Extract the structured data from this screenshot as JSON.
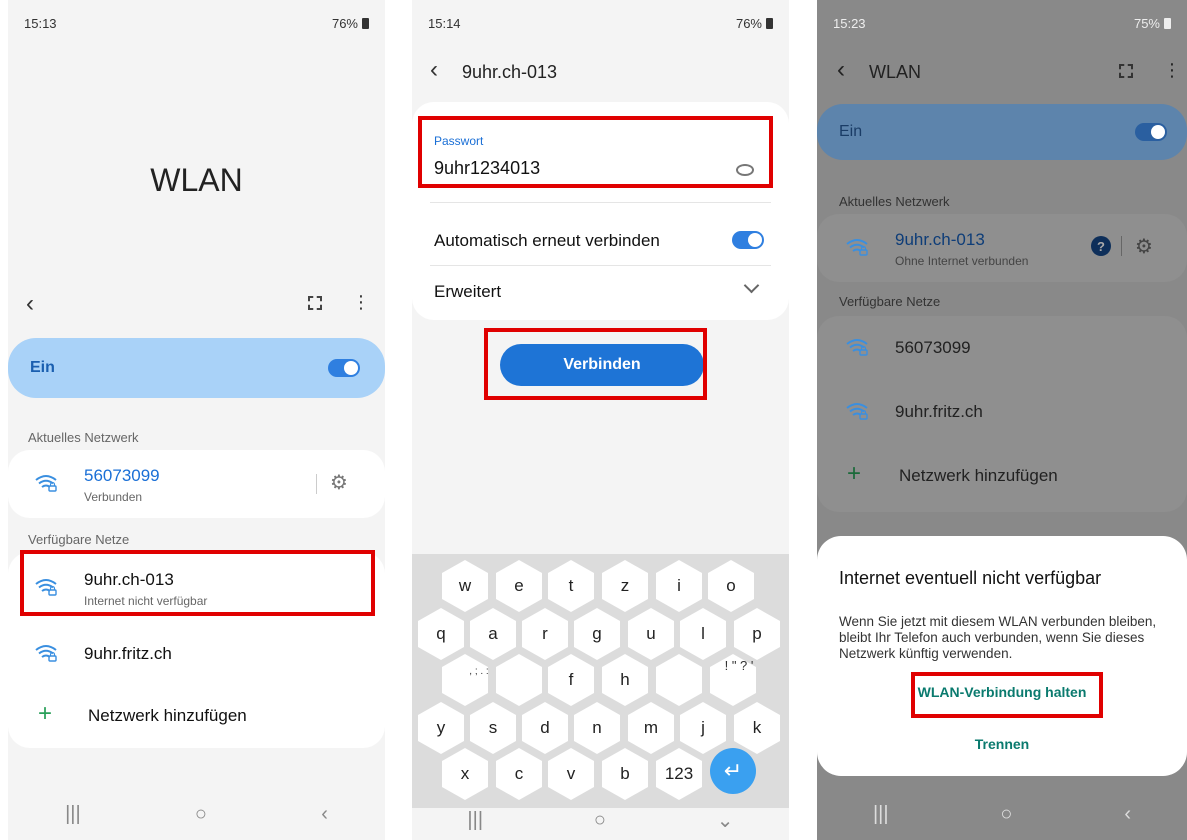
{
  "screen1": {
    "status_time": "15:13",
    "status_battery": "76%",
    "title": "WLAN",
    "on_label": "Ein",
    "current_header": "Aktuelles Netzwerk",
    "current_ssid": "56073099",
    "current_status": "Verbunden",
    "available_header": "Verfügbare Netze",
    "networks": [
      {
        "ssid": "9uhr.ch-013",
        "status": "Internet nicht verfügbar"
      },
      {
        "ssid": "9uhr.fritz.ch",
        "status": ""
      }
    ],
    "add_network": "Netzwerk hinzufügen"
  },
  "screen2": {
    "status_time": "15:14",
    "status_battery": "76%",
    "title": "9uhr.ch-013",
    "password_label": "Passwort",
    "password_value": "9uhr1234013",
    "auto_reconnect": "Automatisch erneut verbinden",
    "advanced": "Erweitert",
    "connect_button": "Verbinden",
    "keyboard_rows": [
      [
        "w",
        "e",
        "t",
        "z",
        "i",
        "o"
      ],
      [
        "q",
        "a",
        "r",
        "g",
        "u",
        "l",
        "p"
      ],
      [
        "f",
        "h"
      ],
      [
        "y",
        "s",
        "d",
        "n",
        "m",
        "j",
        "k"
      ],
      [
        "x",
        "c",
        "v",
        "b",
        "123"
      ]
    ],
    "punct_left": ", ; . :",
    "punct_right": "! \" ? '"
  },
  "screen3": {
    "status_time": "15:23",
    "status_battery": "75%",
    "title": "WLAN",
    "on_label": "Ein",
    "current_header": "Aktuelles Netzwerk",
    "current_ssid": "9uhr.ch-013",
    "current_status": "Ohne Internet verbunden",
    "available_header": "Verfügbare Netze",
    "networks": [
      "56073099",
      "9uhr.fritz.ch"
    ],
    "add_network": "Netzwerk hinzufügen",
    "dialog_title": "Internet eventuell nicht verfügbar",
    "dialog_body": "Wenn Sie jetzt mit diesem WLAN verbunden bleiben, bleibt Ihr Telefon auch verbunden, wenn Sie dieses Netzwerk künftig verwenden.",
    "dialog_keep": "WLAN-Verbindung halten",
    "dialog_disconnect": "Trennen"
  },
  "colors": {
    "accent": "#1a6fd6",
    "toggle": "#2f7fe0",
    "highlight": "#e00000",
    "dialog_action": "#0a7a6e"
  },
  "icons": [
    "wifi-lock-icon",
    "qr-code-icon",
    "more-icon",
    "gear-icon",
    "back-icon",
    "eye-icon",
    "chevron-down-icon",
    "plus-icon",
    "help-icon",
    "enter-icon",
    "recents-icon",
    "home-icon",
    "nav-back-icon"
  ]
}
